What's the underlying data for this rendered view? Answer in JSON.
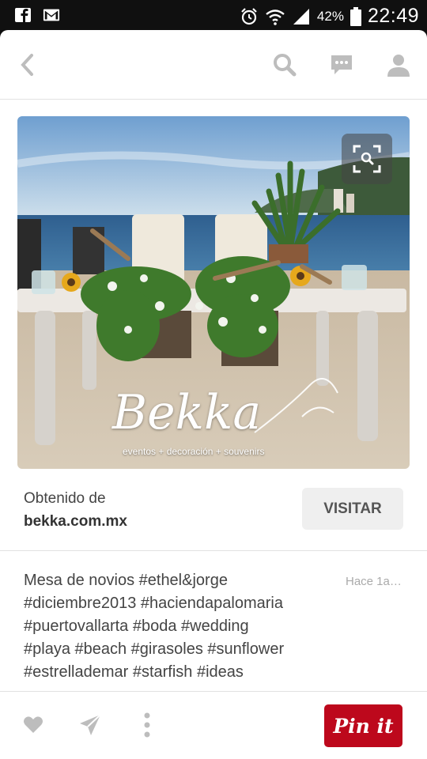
{
  "status_bar": {
    "battery_percent": "42%",
    "time": "22:49"
  },
  "pin": {
    "image_watermark": {
      "brand": "Bekka",
      "tagline": "eventos + decoración + souvenirs"
    },
    "source_label": "Obtenido de",
    "source_domain": "bekka.com.mx",
    "visit_label": "VISITAR",
    "description_lines": [
      "Mesa de novios #ethel&jorge",
      "#diciembre2013 #haciendapalomaria",
      "#puertovallarta #boda #wedding",
      "#playa #beach #girasoles #sunflower",
      "#estrellademar #starfish #ideas"
    ],
    "timestamp": "Hace 1a…"
  },
  "actions": {
    "pinit_label": "Pin it"
  },
  "colors": {
    "pinterest_red": "#bd081c",
    "icon_gray": "#bdbdbd"
  },
  "icons": [
    "facebook-icon",
    "gmail-icon",
    "alarm-icon",
    "wifi-icon",
    "signal-icon",
    "battery-icon",
    "back-icon",
    "search-icon",
    "message-icon",
    "profile-icon",
    "visual-search-icon",
    "heart-icon",
    "send-icon",
    "more-icon"
  ]
}
